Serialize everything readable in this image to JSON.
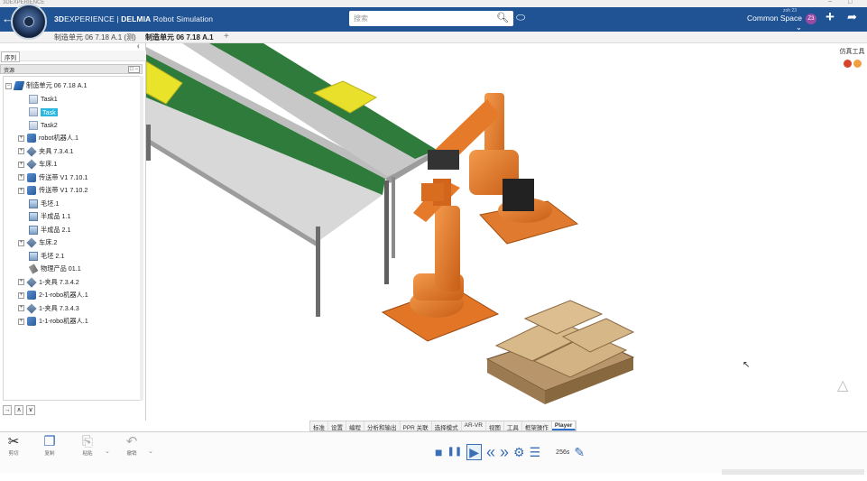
{
  "window": {
    "title": "3DEXPERIENCE",
    "minimize": "−",
    "maximize": "□"
  },
  "header": {
    "brand_bold": "3D",
    "brand_mid": "EXPERIENCE | ",
    "brand_app_bold": "DELMIA",
    "brand_app": " Robot Simulation",
    "search_placeholder": "搜索",
    "user_small": "zoh 23",
    "space_label": "Common Space ⌄",
    "avatar_text": "Z3",
    "search_icon": "magnifier-icon",
    "tag_icon": "tag-icon",
    "add_icon": "plus-icon",
    "share_icon": "share-icon"
  },
  "tabs": [
    {
      "label": "制造单元 06 7.18 A.1 (测)",
      "active": false
    },
    {
      "label": "制造单元 06 7.18 A.1",
      "active": true
    }
  ],
  "tab_add": "+",
  "left_panel": {
    "tab_label": "序列",
    "subheader_label": "资源",
    "subheader_buttons": "□ −",
    "tree": [
      {
        "label": "制造单元 06 7.18 A.1",
        "icon": "root",
        "level": 0,
        "expander": "−"
      },
      {
        "label": "Task1",
        "icon": "task",
        "level": 1,
        "expander": ""
      },
      {
        "label": "Task",
        "icon": "task",
        "level": 1,
        "expander": "",
        "selected": true
      },
      {
        "label": "Task2",
        "icon": "task",
        "level": 1,
        "expander": ""
      },
      {
        "label": "robot机器人.1",
        "icon": "robot",
        "level": 1,
        "expander": "+"
      },
      {
        "label": "夹具 7.3.4.1",
        "icon": "tool",
        "level": 1,
        "expander": "+"
      },
      {
        "label": "车床.1",
        "icon": "tool",
        "level": 1,
        "expander": "+"
      },
      {
        "label": "传送带 V1 7.10.1",
        "icon": "robot",
        "level": 1,
        "expander": "+"
      },
      {
        "label": "传送带 V1 7.10.2",
        "icon": "robot",
        "level": 1,
        "expander": "+"
      },
      {
        "label": "毛坯.1",
        "icon": "part",
        "level": 1,
        "expander": ""
      },
      {
        "label": "半成品 1.1",
        "icon": "part",
        "level": 1,
        "expander": ""
      },
      {
        "label": "半成品 2.1",
        "icon": "part",
        "level": 1,
        "expander": ""
      },
      {
        "label": "车床.2",
        "icon": "tool",
        "level": 1,
        "expander": "+"
      },
      {
        "label": "毛坯 2.1",
        "icon": "part",
        "level": 1,
        "expander": ""
      },
      {
        "label": "物理产品 01.1",
        "icon": "prod",
        "level": 1,
        "expander": ""
      },
      {
        "label": "1-夹具 7.3.4.2",
        "icon": "tool",
        "level": 1,
        "expander": "+"
      },
      {
        "label": "2-1-robo机器人.1",
        "icon": "robot",
        "level": 1,
        "expander": "+"
      },
      {
        "label": "1-夹具 7.3.4.3",
        "icon": "tool",
        "level": 1,
        "expander": "+"
      },
      {
        "label": "1-1-robo机器人.1",
        "icon": "robot",
        "level": 1,
        "expander": "+"
      }
    ],
    "bottom_buttons": [
      "→",
      "∧",
      "∨"
    ]
  },
  "sim_tools": {
    "label": "仿真工具"
  },
  "workbench_tabs": [
    {
      "label": "标准",
      "active": false
    },
    {
      "label": "设置",
      "active": false
    },
    {
      "label": "编程",
      "active": false
    },
    {
      "label": "分析和输出",
      "active": false
    },
    {
      "label": "PPR 关联",
      "active": false
    },
    {
      "label": "选择模式",
      "active": false
    },
    {
      "label": "AR-VR",
      "active": false
    },
    {
      "label": "视图",
      "active": false
    },
    {
      "label": "工具",
      "active": false
    },
    {
      "label": "框架操作",
      "active": false
    },
    {
      "label": "Player",
      "active": true
    }
  ],
  "bottom_tools": [
    {
      "label": "剪切",
      "glyph": "✂",
      "icon": "scissors-icon",
      "disabled": false
    },
    {
      "label": "复制",
      "glyph": "❐",
      "icon": "copy-icon",
      "disabled": false
    },
    {
      "label": "粘贴",
      "glyph": "⎘",
      "icon": "paste-icon",
      "disabled": true
    },
    {
      "label": "撤销",
      "glyph": "↶",
      "icon": "undo-icon",
      "disabled": true
    }
  ],
  "player": {
    "buttons": [
      {
        "name": "stop-button",
        "glyph": "■"
      },
      {
        "name": "pause-button",
        "glyph": "❚❚"
      },
      {
        "name": "play-button",
        "glyph": "▶"
      },
      {
        "name": "rewind-button",
        "glyph": "«"
      },
      {
        "name": "fast-forward-button",
        "glyph": "»"
      },
      {
        "name": "settings-button",
        "glyph": "⚙"
      },
      {
        "name": "list-button",
        "glyph": "☰"
      }
    ],
    "time": "256s",
    "record_glyph": "✎"
  },
  "colors": {
    "header_bg": "#1f5394",
    "robot_orange": "#e8762a",
    "conveyor_green": "#2e7a3a",
    "selection": "#29b7df",
    "accent_blue": "#3a6fb5"
  }
}
